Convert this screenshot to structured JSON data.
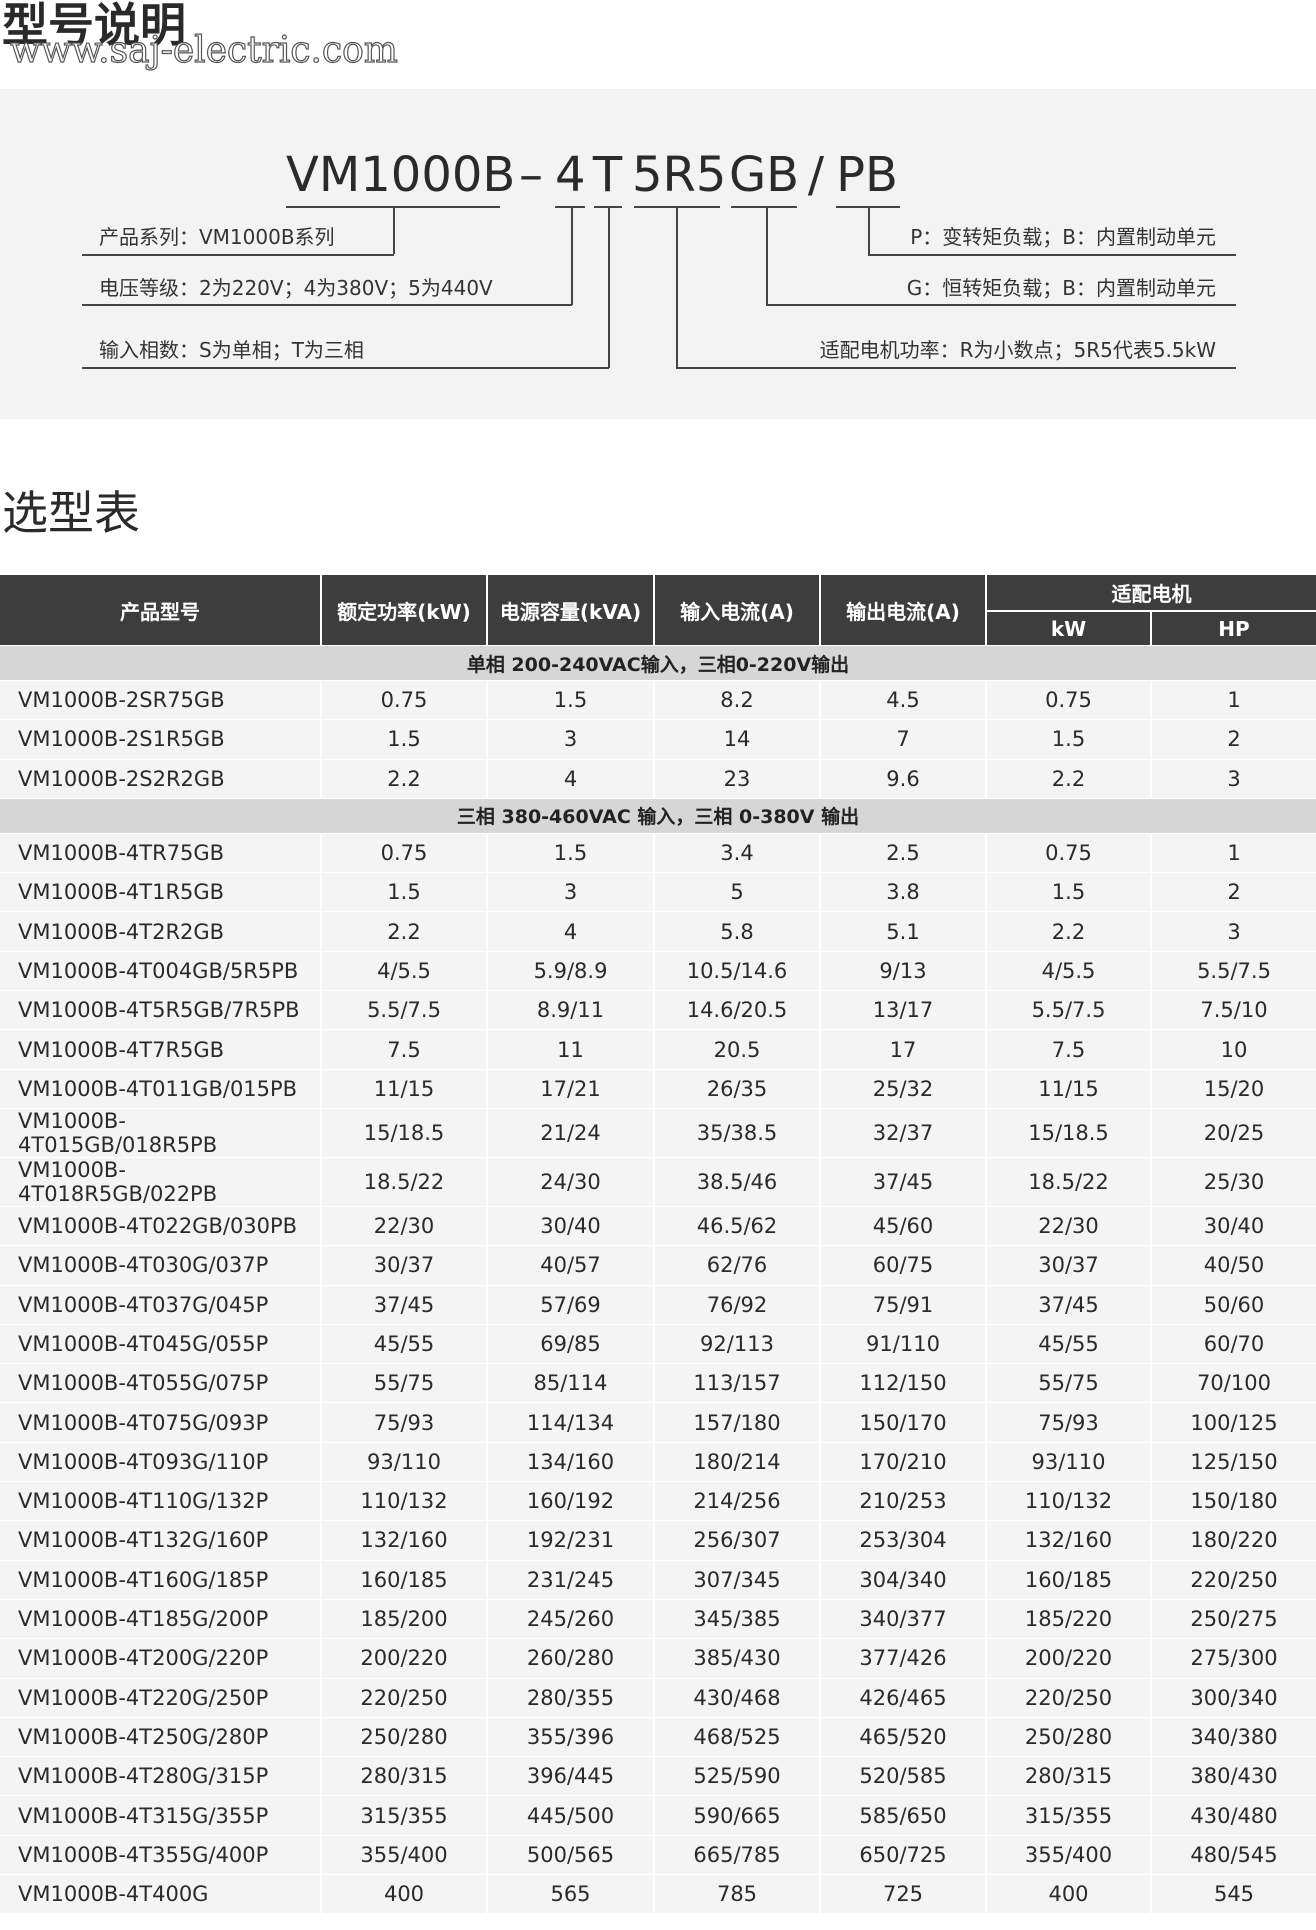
{
  "section1_title": "型号说明",
  "watermark": "www.saj-electric.com",
  "model_code": {
    "series": "VM1000B",
    "dash": "–",
    "voltage": "4",
    "phase": "T",
    "power": "5R5",
    "gb": "GB",
    "slash": "/",
    "pb": "PB"
  },
  "model_labels": {
    "series": "产品系列：VM1000B系列",
    "voltage": "电压等级：2为220V；4为380V；5为440V",
    "phase": "输入相数：S为单相；T为三相",
    "pb": "P：变转矩负载；B：内置制动单元",
    "gb": "G：恒转矩负载；B：内置制动单元",
    "power": "适配电机功率：R为小数点；5R5代表5.5kW"
  },
  "section2_title": "选型表",
  "table": {
    "headers": {
      "model": "产品型号",
      "rated_power": "额定功率(kW)",
      "capacity": "电源容量(kVA)",
      "input_current": "输入电流(A)",
      "output_current": "输出电流(A)",
      "motor": "适配电机",
      "kw": "kW",
      "hp": "HP"
    },
    "groups": [
      {
        "title": "单相 200-240VAC输入，三相0-220V输出",
        "rows": [
          [
            "VM1000B-2SR75GB",
            "0.75",
            "1.5",
            "8.2",
            "4.5",
            "0.75",
            "1"
          ],
          [
            "VM1000B-2S1R5GB",
            "1.5",
            "3",
            "14",
            "7",
            "1.5",
            "2"
          ],
          [
            "VM1000B-2S2R2GB",
            "2.2",
            "4",
            "23",
            "9.6",
            "2.2",
            "3"
          ]
        ]
      },
      {
        "title": "三相 380-460VAC 输入，三相 0-380V 输出",
        "rows": [
          [
            "VM1000B-4TR75GB",
            "0.75",
            "1.5",
            "3.4",
            "2.5",
            "0.75",
            "1"
          ],
          [
            "VM1000B-4T1R5GB",
            "1.5",
            "3",
            "5",
            "3.8",
            "1.5",
            "2"
          ],
          [
            "VM1000B-4T2R2GB",
            "2.2",
            "4",
            "5.8",
            "5.1",
            "2.2",
            "3"
          ],
          [
            "VM1000B-4T004GB/5R5PB",
            "4/5.5",
            "5.9/8.9",
            "10.5/14.6",
            "9/13",
            "4/5.5",
            "5.5/7.5"
          ],
          [
            "VM1000B-4T5R5GB/7R5PB",
            "5.5/7.5",
            "8.9/11",
            "14.6/20.5",
            "13/17",
            "5.5/7.5",
            "7.5/10"
          ],
          [
            "VM1000B-4T7R5GB",
            "7.5",
            "11",
            "20.5",
            "17",
            "7.5",
            "10"
          ],
          [
            "VM1000B-4T011GB/015PB",
            "11/15",
            "17/21",
            "26/35",
            "25/32",
            "11/15",
            "15/20"
          ],
          [
            "VM1000B-4T015GB/018R5PB",
            "15/18.5",
            "21/24",
            "35/38.5",
            "32/37",
            "15/18.5",
            "20/25"
          ],
          [
            "VM1000B-4T018R5GB/022PB",
            "18.5/22",
            "24/30",
            "38.5/46",
            "37/45",
            "18.5/22",
            "25/30"
          ],
          [
            "VM1000B-4T022GB/030PB",
            "22/30",
            "30/40",
            "46.5/62",
            "45/60",
            "22/30",
            "30/40"
          ],
          [
            "VM1000B-4T030G/037P",
            "30/37",
            "40/57",
            "62/76",
            "60/75",
            "30/37",
            "40/50"
          ],
          [
            "VM1000B-4T037G/045P",
            "37/45",
            "57/69",
            "76/92",
            "75/91",
            "37/45",
            "50/60"
          ],
          [
            "VM1000B-4T045G/055P",
            "45/55",
            "69/85",
            "92/113",
            "91/110",
            "45/55",
            "60/70"
          ],
          [
            "VM1000B-4T055G/075P",
            "55/75",
            "85/114",
            "113/157",
            "112/150",
            "55/75",
            "70/100"
          ],
          [
            "VM1000B-4T075G/093P",
            "75/93",
            "114/134",
            "157/180",
            "150/170",
            "75/93",
            "100/125"
          ],
          [
            "VM1000B-4T093G/110P",
            "93/110",
            "134/160",
            "180/214",
            "170/210",
            "93/110",
            "125/150"
          ],
          [
            "VM1000B-4T110G/132P",
            "110/132",
            "160/192",
            "214/256",
            "210/253",
            "110/132",
            "150/180"
          ],
          [
            "VM1000B-4T132G/160P",
            "132/160",
            "192/231",
            "256/307",
            "253/304",
            "132/160",
            "180/220"
          ],
          [
            "VM1000B-4T160G/185P",
            "160/185",
            "231/245",
            "307/345",
            "304/340",
            "160/185",
            "220/250"
          ],
          [
            "VM1000B-4T185G/200P",
            "185/200",
            "245/260",
            "345/385",
            "340/377",
            "185/220",
            "250/275"
          ],
          [
            "VM1000B-4T200G/220P",
            "200/220",
            "260/280",
            "385/430",
            "377/426",
            "200/220",
            "275/300"
          ],
          [
            "VM1000B-4T220G/250P",
            "220/250",
            "280/355",
            "430/468",
            "426/465",
            "220/250",
            "300/340"
          ],
          [
            "VM1000B-4T250G/280P",
            "250/280",
            "355/396",
            "468/525",
            "465/520",
            "250/280",
            "340/380"
          ],
          [
            "VM1000B-4T280G/315P",
            "280/315",
            "396/445",
            "525/590",
            "520/585",
            "280/315",
            "380/430"
          ],
          [
            "VM1000B-4T315G/355P",
            "315/355",
            "445/500",
            "590/665",
            "585/650",
            "315/355",
            "430/480"
          ],
          [
            "VM1000B-4T355G/400P",
            "355/400",
            "500/565",
            "665/785",
            "650/725",
            "355/400",
            "480/545"
          ],
          [
            "VM1000B-4T400G",
            "400",
            "565",
            "785",
            "725",
            "400",
            "545"
          ]
        ]
      }
    ]
  }
}
